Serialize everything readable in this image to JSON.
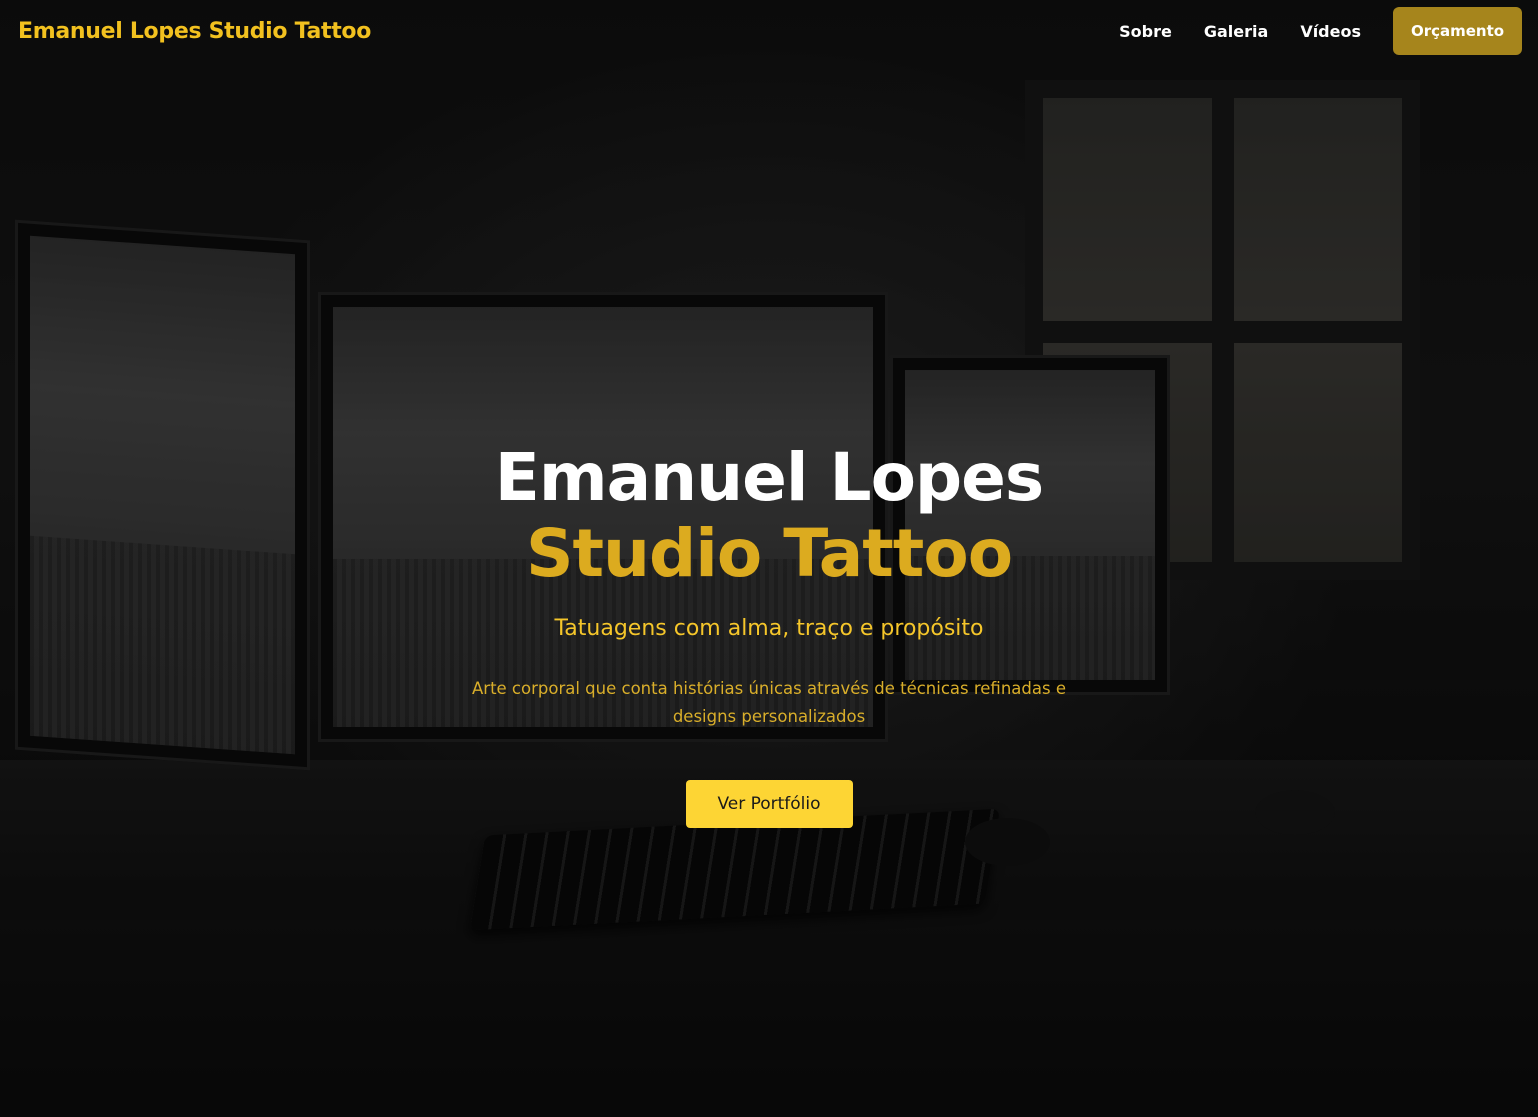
{
  "navbar": {
    "brand": "Emanuel Lopes Studio Tattoo",
    "links": [
      {
        "label": "Sobre"
      },
      {
        "label": "Galeria"
      },
      {
        "label": "Vídeos"
      }
    ],
    "cta_label": "Orçamento"
  },
  "hero": {
    "title_line1": "Emanuel Lopes",
    "title_line2": "Studio Tattoo",
    "tagline": "Tatuagens com alma, traço e propósito",
    "description": "Arte corporal que conta histórias únicas através de técnicas refinadas e designs personalizados",
    "button_label": "Ver Portfólio"
  },
  "colors": {
    "brand_gold": "#f2c11f",
    "cta_bg": "#a6851c",
    "title_gold": "#dcab1f",
    "button_yellow": "#fdd534"
  }
}
